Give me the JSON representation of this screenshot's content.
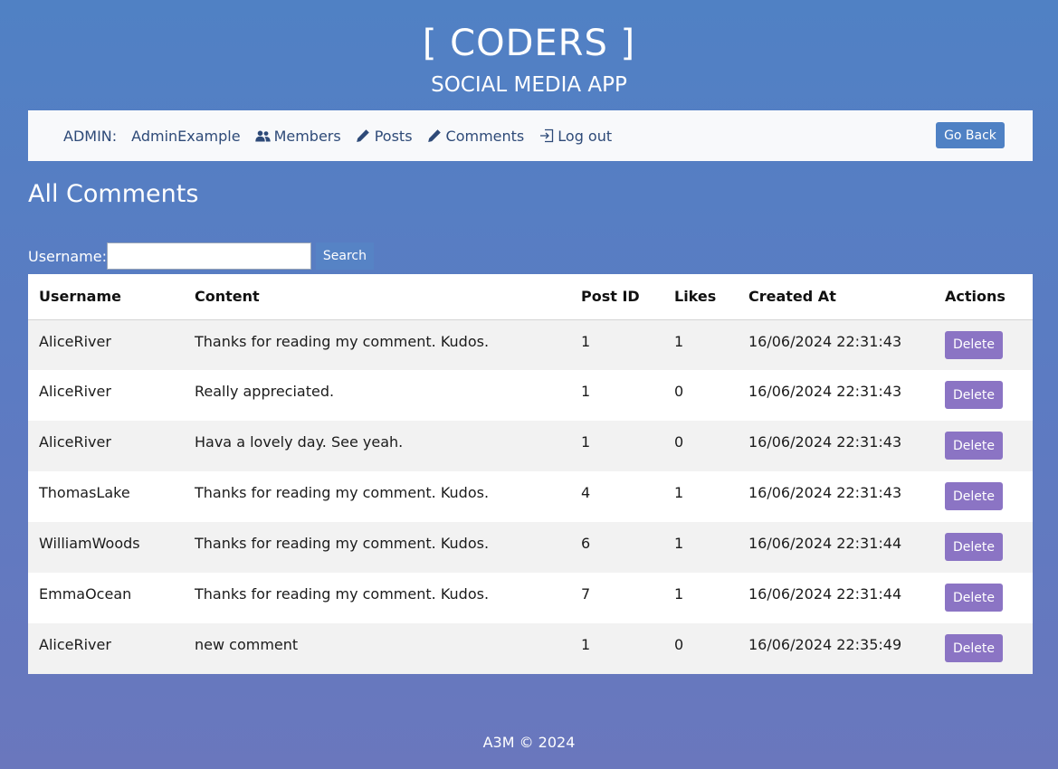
{
  "header": {
    "title": "[ CODERS ]",
    "subtitle": "SOCIAL MEDIA APP"
  },
  "nav": {
    "admin_label": "ADMIN:",
    "admin_name": "AdminExample",
    "members_label": "Members",
    "posts_label": "Posts",
    "comments_label": "Comments",
    "logout_label": "Log out",
    "go_back_label": "Go Back",
    "icons": {
      "members": "users-icon",
      "posts": "pencil-icon",
      "comments": "pencil-icon",
      "logout": "log-out-icon"
    }
  },
  "main": {
    "heading": "All Comments",
    "search": {
      "label": "Username:",
      "value": "",
      "placeholder": "",
      "button_label": "Search"
    },
    "table": {
      "headers": [
        "Username",
        "Content",
        "Post ID",
        "Likes",
        "Created At",
        "Actions"
      ],
      "rows": [
        {
          "username": "AliceRiver",
          "content": "Thanks for reading my comment. Kudos.",
          "post_id": "1",
          "likes": "1",
          "created_at": "16/06/2024 22:31:43",
          "action": "Delete"
        },
        {
          "username": "AliceRiver",
          "content": "Really appreciated.",
          "post_id": "1",
          "likes": "0",
          "created_at": "16/06/2024 22:31:43",
          "action": "Delete"
        },
        {
          "username": "AliceRiver",
          "content": "Hava a lovely day. See yeah.",
          "post_id": "1",
          "likes": "0",
          "created_at": "16/06/2024 22:31:43",
          "action": "Delete"
        },
        {
          "username": "ThomasLake",
          "content": "Thanks for reading my comment. Kudos.",
          "post_id": "4",
          "likes": "1",
          "created_at": "16/06/2024 22:31:43",
          "action": "Delete"
        },
        {
          "username": "WilliamWoods",
          "content": "Thanks for reading my comment. Kudos.",
          "post_id": "6",
          "likes": "1",
          "created_at": "16/06/2024 22:31:44",
          "action": "Delete"
        },
        {
          "username": "EmmaOcean",
          "content": "Thanks for reading my comment. Kudos.",
          "post_id": "7",
          "likes": "1",
          "created_at": "16/06/2024 22:31:44",
          "action": "Delete"
        },
        {
          "username": "AliceRiver",
          "content": "new comment",
          "post_id": "1",
          "likes": "0",
          "created_at": "16/06/2024 22:35:49",
          "action": "Delete"
        }
      ]
    }
  },
  "footer": {
    "text": "A3M © 2024"
  },
  "colors": {
    "background_top": "#5081c4",
    "background_bottom": "#6a77bd",
    "nav_background": "#f8f9fb",
    "nav_text": "#2e4a78",
    "go_back_button": "#4f81c4",
    "delete_button": "#8b74c4",
    "row_stripe": "#f2f2f2"
  }
}
